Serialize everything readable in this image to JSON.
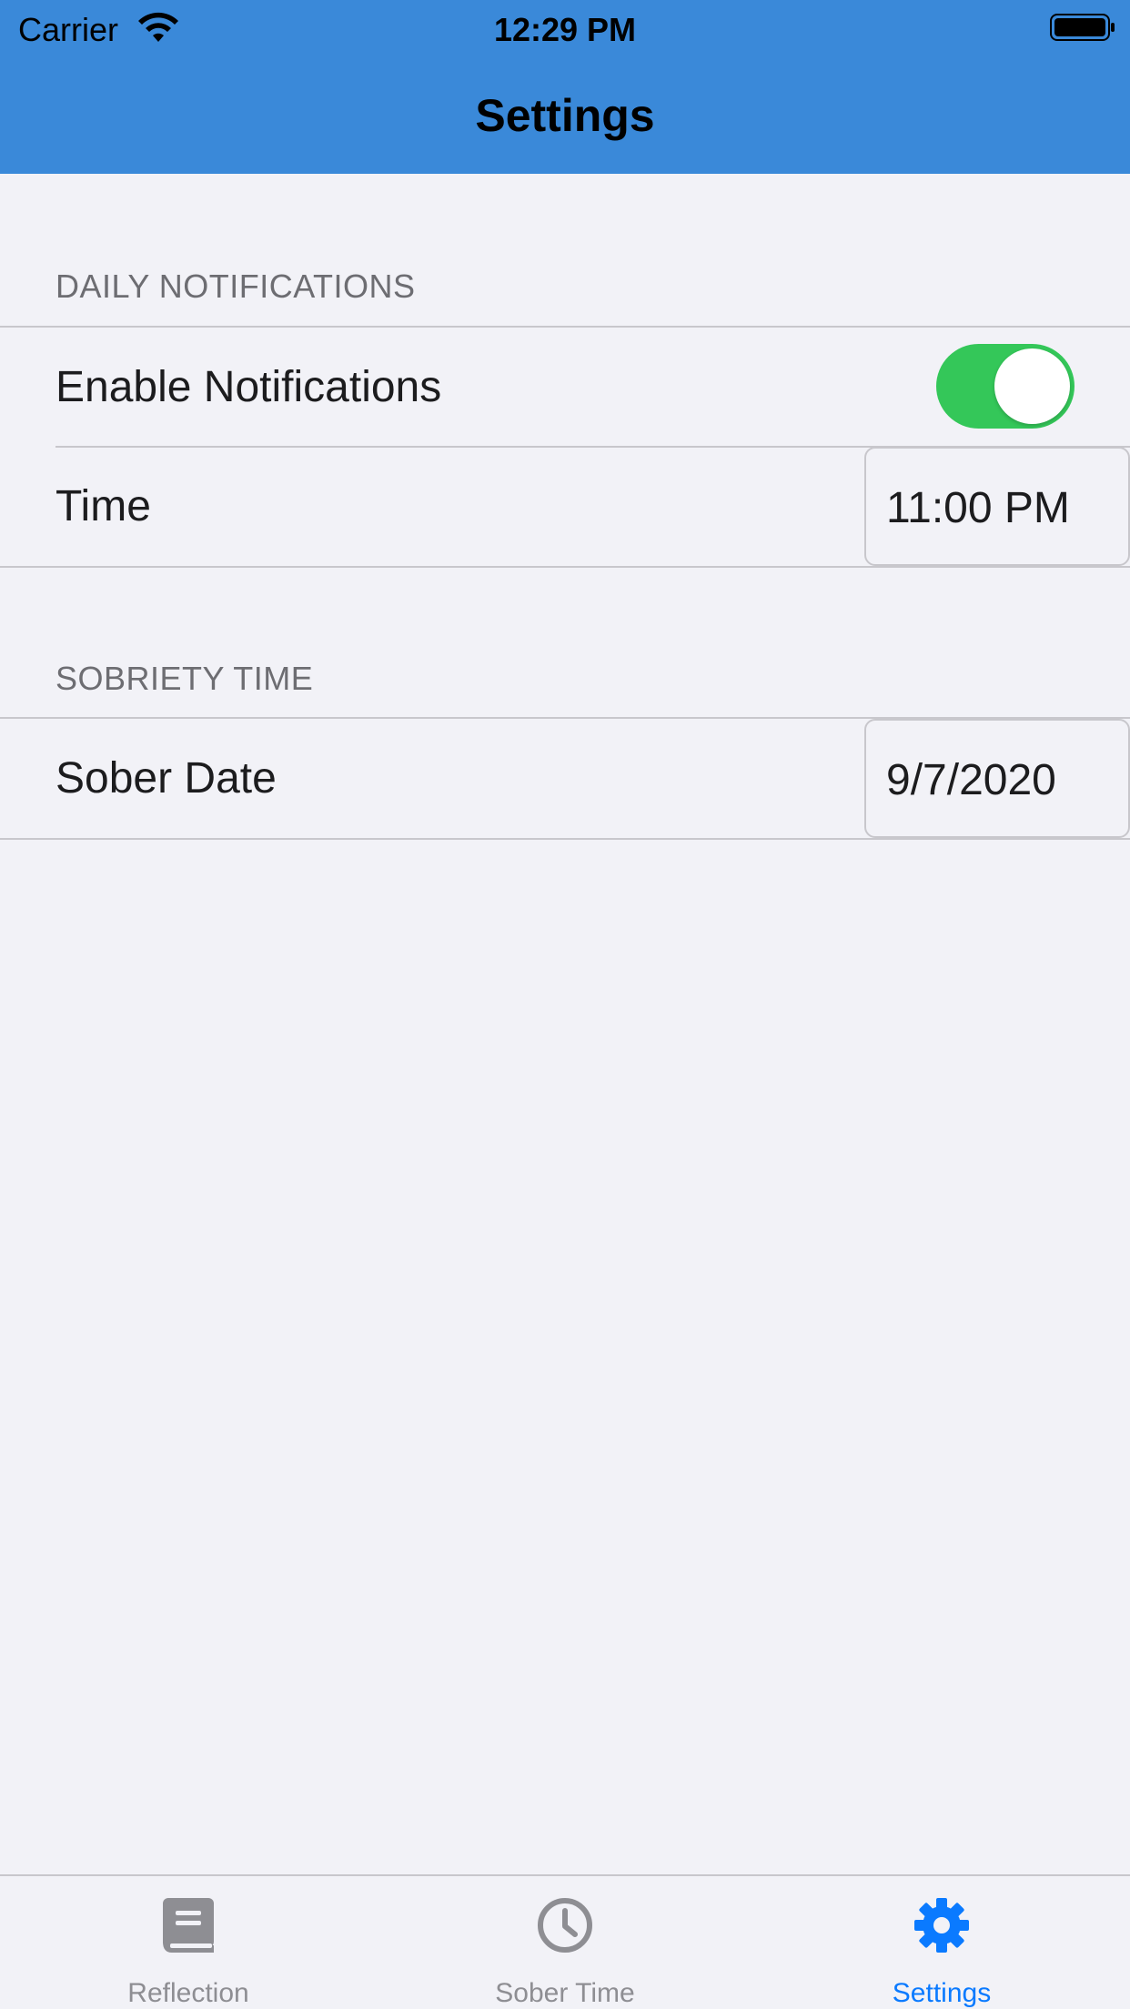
{
  "status_bar": {
    "carrier": "Carrier",
    "time": "12:29 PM",
    "wifi_icon": "wifi-icon",
    "battery_icon": "battery-full-icon"
  },
  "nav": {
    "title": "Settings"
  },
  "sections": {
    "notifications": {
      "header": "DAILY NOTIFICATIONS",
      "enable_label": "Enable Notifications",
      "enable_state": true,
      "time_label": "Time",
      "time_value": "11:00 PM"
    },
    "sobriety": {
      "header": "SOBRIETY TIME",
      "date_label": "Sober Date",
      "date_value": "9/7/2020"
    }
  },
  "tabs": [
    {
      "label": "Reflection",
      "icon": "book-icon",
      "active": false
    },
    {
      "label": "Sober Time",
      "icon": "clock-icon",
      "active": false
    },
    {
      "label": "Settings",
      "icon": "gear-icon",
      "active": true
    }
  ],
  "colors": {
    "header_bg": "#3a89d9",
    "toggle_on": "#34c759",
    "tab_active": "#0a7aff",
    "tab_inactive": "#8e8e93"
  }
}
